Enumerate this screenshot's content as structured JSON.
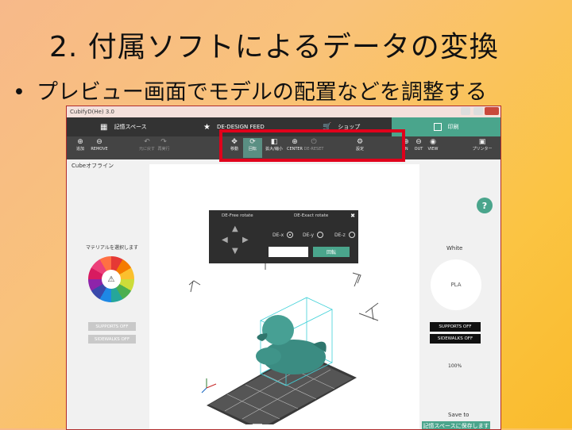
{
  "slide": {
    "title": "2. 付属ソフトによるデータの変換",
    "bullet_mark": "•",
    "bullet": "プレビュー画面でモデルの配置などを調整する"
  },
  "window": {
    "title": "CubifyD(He) 3.0"
  },
  "nav": {
    "library": "記憶スペース",
    "design_feed": "DE-DESIGN FEED",
    "shop": "ショップ",
    "print": "印刷"
  },
  "toolbar": {
    "add": "追加",
    "remove": "REMOVE",
    "undo": "元に戻す",
    "redo": "再実行",
    "move": "移動",
    "rotate": "回転",
    "scale": "拡大/縮小",
    "center": "CENTER",
    "reset": "DE-RESET",
    "settings": "設定",
    "zoom_in": "IN",
    "zoom_out": "OUT",
    "view": "VIEW",
    "printer": "プリンター"
  },
  "sidebar_left": {
    "status": "Cubeオフライン",
    "material_label": "マテリアルを選択します",
    "supports": "SUPPORTS OFF",
    "sidewalks": "SIDEWALKS OFF"
  },
  "sidebar_right": {
    "color": "White",
    "material": "PLA",
    "percent": "100%",
    "supports": "SUPPORTS OFF",
    "sidewalks": "SIDEWALKS OFF",
    "save_to": "Save to",
    "save_button": "記憶スペースに保存します"
  },
  "rotate_panel": {
    "free": "DE-Free rotate",
    "exact": "DE-Exact rotate",
    "x": "DE-x",
    "y": "DE-y",
    "z": "DE-z",
    "apply": "回転",
    "selected_axis": "x"
  },
  "help": "?",
  "colors": {
    "accent": "#4aa58c",
    "highlight": "#e0001b",
    "model": "#3b8c82"
  }
}
